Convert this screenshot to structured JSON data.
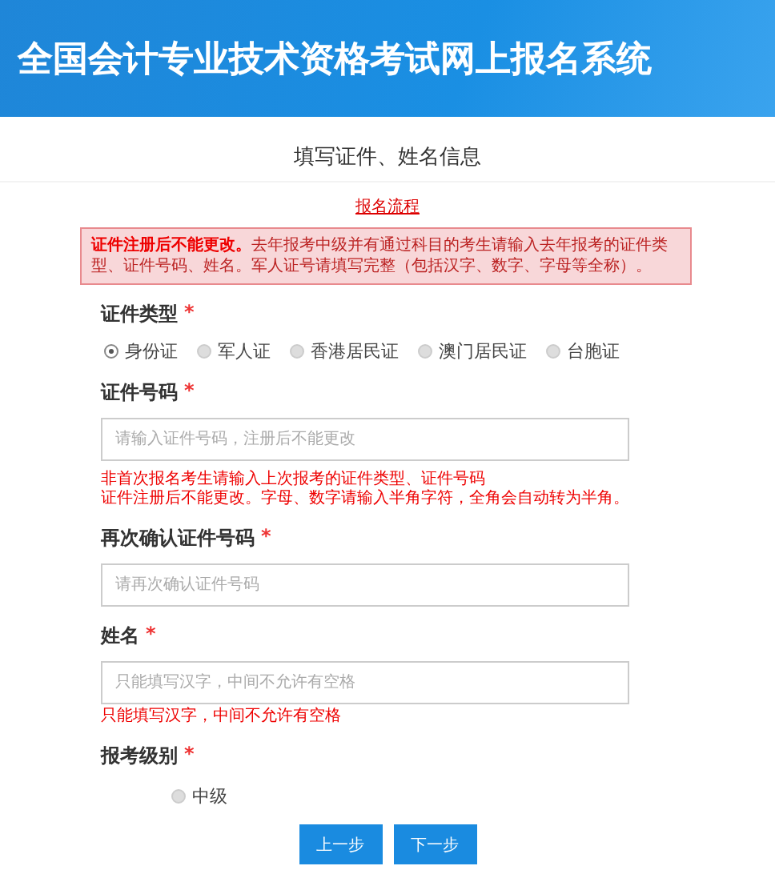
{
  "header": {
    "title": "全国会计专业技术资格考试网上报名系统"
  },
  "page_title": "填写证件、姓名信息",
  "process_link": "报名流程",
  "notice": "**证件注册后不能更改。**去年报考中级并有通过科目的考生请输入去年报考的证件类型、证件号码、姓名。军人证号请填写完整（包括汉字、数字、字母等全称）。",
  "fields": [
    {
      "kind": "radio",
      "label": "证件类型",
      "required_mark": "*",
      "options": [
        {
          "label": "身份证",
          "selected": true
        },
        {
          "label": "军人证",
          "selected": false
        },
        {
          "label": "香港居民证",
          "selected": false
        },
        {
          "label": "澳门居民证",
          "selected": false
        },
        {
          "label": "台胞证",
          "selected": false
        }
      ]
    },
    {
      "kind": "text",
      "label": "证件号码",
      "required_mark": "*",
      "placeholder": "请输入证件号码，注册后不能更改",
      "hints": [
        "非首次报名考生请输入上次报考的证件类型、证件号码",
        "证件注册后不能更改。字母、数字请输入半角字符，全角会自动转为半角。"
      ]
    },
    {
      "kind": "text",
      "label": "再次确认证件号码",
      "required_mark": "*",
      "placeholder": "请再次确认证件号码"
    },
    {
      "kind": "text",
      "label": "姓名",
      "required_mark": "*",
      "placeholder": "只能填写汉字，中间不允许有空格",
      "hints": [
        "只能填写汉字，中间不允许有空格"
      ]
    },
    {
      "kind": "level-radio",
      "label": "报考级别",
      "required_mark": "*",
      "options": [
        {
          "label": "中级",
          "selected": false
        }
      ]
    }
  ],
  "buttons": [
    "上一步",
    "下一步"
  ]
}
